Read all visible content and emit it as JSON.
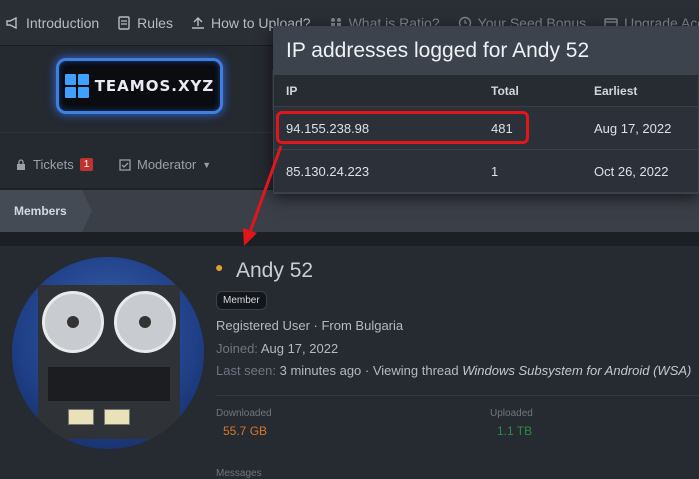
{
  "nav": {
    "items": [
      {
        "label": "Introduction",
        "icon": "megaphone-icon"
      },
      {
        "label": "Rules",
        "icon": "document-icon"
      },
      {
        "label": "How to Upload?",
        "icon": "upload-icon"
      },
      {
        "label": "What is Ratio?",
        "icon": "people-icon"
      },
      {
        "label": "Your Seed Bonus",
        "icon": "clock-icon"
      },
      {
        "label": "Upgrade Acco...",
        "icon": "card-icon"
      }
    ]
  },
  "logo": {
    "text": "TEAMOS.XYZ"
  },
  "subnav": {
    "tickets_label": "Tickets",
    "tickets_count": "1",
    "moderator_label": "Moderator"
  },
  "breadcrumb": {
    "label": "Members"
  },
  "popup": {
    "title": "IP addresses logged for Andy 52",
    "headers": {
      "ip": "IP",
      "total": "Total",
      "earliest": "Earliest"
    },
    "rows": [
      {
        "ip": "94.155.238.98",
        "total": "481",
        "earliest": "Aug 17, 2022"
      },
      {
        "ip": "85.130.24.223",
        "total": "1",
        "earliest": "Oct 26, 2022"
      }
    ]
  },
  "profile": {
    "username": "Andy 52",
    "role_badge": "Member",
    "info_line": "Registered User · From Bulgaria",
    "joined_label": "Joined:",
    "joined_value": "Aug 17, 2022",
    "last_seen_label": "Last seen:",
    "last_seen_value": "3 minutes ago · Viewing thread",
    "last_seen_thread": "Windows Subsystem for Android (WSA)",
    "downloaded_label": "Downloaded",
    "downloaded_value": "55.7 GB",
    "uploaded_label": "Uploaded",
    "uploaded_value": "1.1 TB",
    "messages_label": "Messages"
  },
  "colors": {
    "highlight": "#e0161b",
    "downloaded": "#d9782a",
    "uploaded": "#2e8a48",
    "badge": "#c0312f"
  }
}
